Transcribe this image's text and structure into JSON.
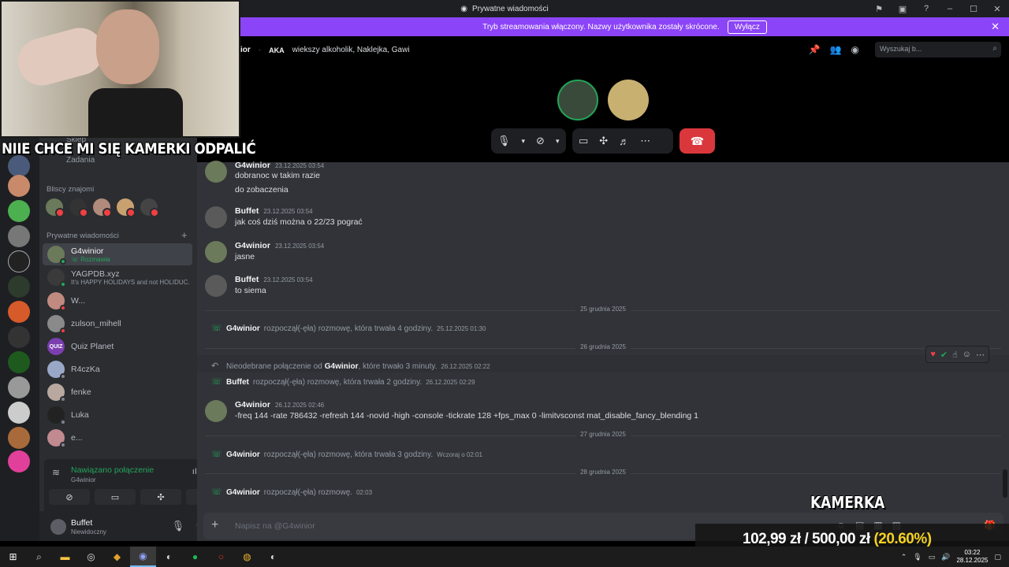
{
  "window": {
    "title": "Prywatne wiadomości"
  },
  "banner": {
    "text": "Tryb streamowania włączony. Nazwy użytkownika zostały skrócone.",
    "button": "Wyłącz"
  },
  "sidebar": {
    "shop": "Sklep",
    "tasks": "Zadania",
    "friends_label": "Bliscy znajomi",
    "dm_label": "Prywatne wiadomości",
    "dms": [
      {
        "name": "G4winior",
        "sub": "Rozmawia"
      },
      {
        "name": "YAGPDB.xyz",
        "sub": "It's HAPPY HOLIDAYS and not HOLIDUC..."
      },
      {
        "name": "W...",
        "sub": ""
      },
      {
        "name": "zulson_mihell",
        "sub": ""
      },
      {
        "name": "Quiz Planet",
        "sub": ""
      },
      {
        "name": "R4czKa",
        "sub": ""
      },
      {
        "name": "fenke",
        "sub": ""
      },
      {
        "name": "Luka",
        "sub": ""
      },
      {
        "name": "e...",
        "sub": ""
      }
    ]
  },
  "voice": {
    "status": "Nawiązano połączenie",
    "channel": "G4winior"
  },
  "user": {
    "name": "Buffet",
    "status": "Niewidoczny"
  },
  "header": {
    "name": "ior",
    "aka": "AKA",
    "aliases": "wiekszy alkoholik, Naklejka, Gawi",
    "search_placeholder": "Wyszukaj b..."
  },
  "messages": [
    {
      "author": "G4winior",
      "ts": "23.12.2025 03:54",
      "lines": [
        "dobranoc w takim razie",
        "do zobaczenia"
      ]
    },
    {
      "author": "Buffet",
      "ts": "23.12.2025 03:54",
      "lines": [
        "jak coś dziś można o 22/23 pograć"
      ]
    },
    {
      "author": "G4winior",
      "ts": "23.12.2025 03:54",
      "lines": [
        "jasne"
      ]
    },
    {
      "author": "Buffet",
      "ts": "23.12.2025 03:54",
      "lines": [
        "to siema"
      ]
    }
  ],
  "dates": {
    "d25": "25 grudnia 2025",
    "d26": "26 grudnia 2025",
    "d27": "27 grudnia 2025",
    "d28": "28 grudnia 2025"
  },
  "system": {
    "s1": {
      "who": "G4winior",
      "text": "rozpoczął(-ęła) rozmowę, która trwała 4 godziny.",
      "ts": "25.12.2025 01:30"
    },
    "s2": {
      "pre": "Nieodebrane połączenie od",
      "who": "G4winior",
      "text": ", które trwało 3 minuty.",
      "ts": "26.12.2025 02:22"
    },
    "s3": {
      "who": "Buffet",
      "text": "rozpoczął(-ęła) rozmowę, która trwała 2 godziny.",
      "ts": "26.12.2025 02:29"
    },
    "s4": {
      "who": "G4winior",
      "text": "rozpoczął(-ęła) rozmowę, która trwała 3 godziny.",
      "ts": "Wczoraj o 02:01"
    },
    "s5": {
      "who": "G4winior",
      "text": "rozpoczął(-ęła) rozmowę.",
      "ts": "02:03"
    }
  },
  "cmd_msg": {
    "author": "G4winior",
    "ts": "26.12.2025 02:46",
    "text": "-freq 144 -rate 786432 -refresh 144 -novid -high -console -tickrate 128 +fps_max 0 -limitvsconst mat_disable_fancy_blending 1"
  },
  "composer": {
    "placeholder": "Napisz na @G4winior"
  },
  "overlay": {
    "caption": "NIIE CHCE MI SIĘ KAMERKI ODPALIĆ",
    "kamerka": "KAMERKA",
    "current": "102,99 zł",
    "sep": "/",
    "goal": "500,00 zł",
    "percent": "(20.60%)"
  },
  "clock": {
    "time": "03:22",
    "date": "28.12.2025"
  },
  "colors": {
    "accent": "#8b44f7",
    "online": "#23a55a",
    "hangup": "#da373c",
    "dnd": "#f23f43"
  }
}
